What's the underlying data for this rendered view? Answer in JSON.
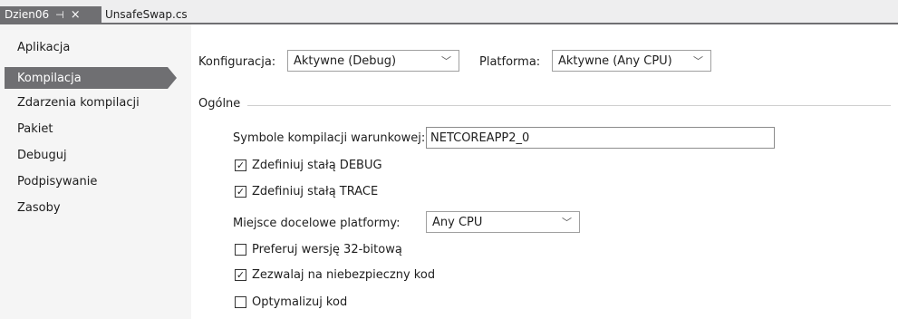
{
  "tabs": {
    "active": {
      "label": "Dzien06",
      "pin_icon": "⊣",
      "close_icon": "×"
    },
    "inactive": {
      "label": "UnsafeSwap.cs"
    }
  },
  "sidebar": {
    "items": [
      {
        "label": "Aplikacja"
      },
      {
        "label": "Kompilacja",
        "selected": true
      },
      {
        "label": "Zdarzenia kompilacji"
      },
      {
        "label": "Pakiet"
      },
      {
        "label": "Debuguj"
      },
      {
        "label": "Podpisywanie"
      },
      {
        "label": "Zasoby"
      }
    ]
  },
  "toolbar": {
    "config_label": "Konfiguracja:",
    "config_value": "Aktywne (Debug)",
    "platform_label": "Platforma:",
    "platform_value": "Aktywne (Any CPU)"
  },
  "general": {
    "section_title": "Ogólne",
    "symbols_label": "Symbole kompilacji warunkowej:",
    "symbols_value": "NETCOREAPP2_0",
    "debug_label": "Zdefiniuj stałą DEBUG",
    "trace_label": "Zdefiniuj stałą TRACE",
    "target_label": "Miejsce docelowe platformy:",
    "target_value": "Any CPU",
    "prefer32_label": "Preferuj wersję 32-bitową",
    "unsafe_label": "Zezwalaj na niebezpieczny kod",
    "optimize_label": "Optymalizuj kod",
    "check_mark": "✓",
    "dropdown_icon": "﹀"
  },
  "checkboxes": {
    "debug": true,
    "trace": true,
    "prefer32": false,
    "unsafe": true,
    "optimize": false
  },
  "colors": {
    "accent": "#6f6f72",
    "background": "#f5f5f5",
    "panel": "#ffffff"
  }
}
